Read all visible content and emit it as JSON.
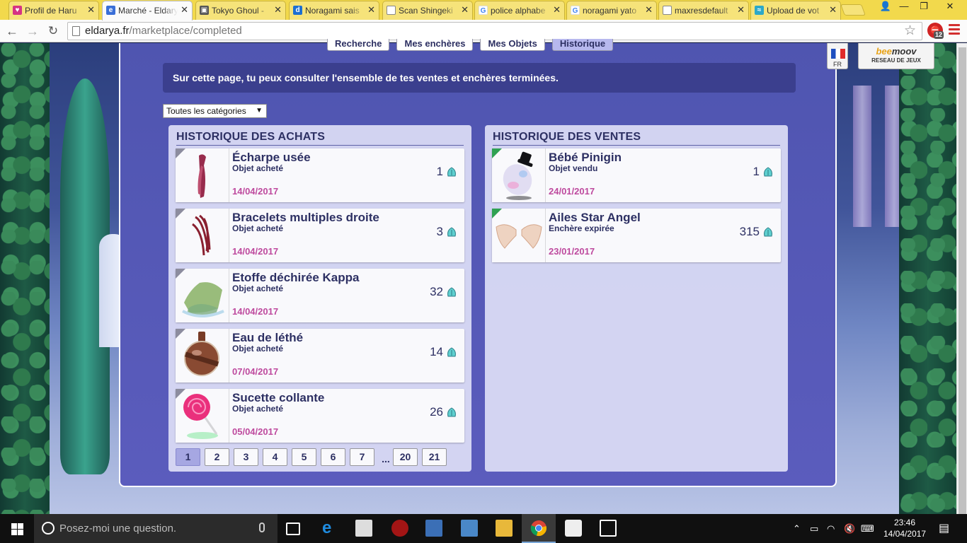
{
  "browser": {
    "tabs": [
      {
        "label": "Profil de Haru",
        "favicon": "heart",
        "color": "#d63384"
      },
      {
        "label": "Marché - Eldarya",
        "favicon": "e",
        "color": "#3a6fd8",
        "active": true
      },
      {
        "label": "Tokyo Ghoul -",
        "favicon": "img",
        "color": "#555555"
      },
      {
        "label": "Noragami sais",
        "favicon": "d",
        "color": "#1d6fd1"
      },
      {
        "label": "Scan Shingeki",
        "favicon": "doc",
        "color": "#888888"
      },
      {
        "label": "police alphabe",
        "favicon": "G",
        "color": "#4285f4"
      },
      {
        "label": "noragami yato",
        "favicon": "G",
        "color": "#4285f4"
      },
      {
        "label": "maxresdefault",
        "favicon": "doc",
        "color": "#888888"
      },
      {
        "label": "Upload de vot",
        "favicon": "upload",
        "color": "#2ca8c8"
      }
    ],
    "url_domain": "eldarya.fr",
    "url_path": "/marketplace/completed",
    "extension_badge": "12"
  },
  "lang": {
    "code": "FR"
  },
  "beemoov": {
    "logo_left": "bee",
    "logo_right": "moov",
    "subtitle": "RESEAU DE JEUX"
  },
  "subtabs": [
    "Recherche",
    "Mes enchères",
    "Mes Objets",
    "Historique"
  ],
  "info_text": "Sur cette page, tu peux consulter l'ensemble de tes ventes et enchères terminées.",
  "category_select": {
    "value": "Toutes les catégories"
  },
  "purchases": {
    "title": "HISTORIQUE DES ACHATS",
    "items": [
      {
        "name": "Écharpe usée",
        "status": "Objet acheté",
        "date": "14/04/2017",
        "price": "1",
        "icon": "scarf-icon"
      },
      {
        "name": "Bracelets multiples droite",
        "status": "Objet acheté",
        "date": "14/04/2017",
        "price": "3",
        "icon": "bracelets-icon"
      },
      {
        "name": "Etoffe déchirée Kappa",
        "status": "Objet acheté",
        "date": "14/04/2017",
        "price": "32",
        "icon": "cloth-icon"
      },
      {
        "name": "Eau de léthé",
        "status": "Objet acheté",
        "date": "07/04/2017",
        "price": "14",
        "icon": "potion-icon"
      },
      {
        "name": "Sucette collante",
        "status": "Objet acheté",
        "date": "05/04/2017",
        "price": "26",
        "icon": "lollipop-icon"
      }
    ],
    "pages": [
      "1",
      "2",
      "3",
      "4",
      "5",
      "6",
      "7",
      "...",
      "20",
      "21"
    ],
    "current_page": "1"
  },
  "sales": {
    "title": "HISTORIQUE DES VENTES",
    "items": [
      {
        "name": "Bébé Pinigin",
        "status": "Objet vendu",
        "date": "24/01/2017",
        "price": "1",
        "icon": "egg-icon"
      },
      {
        "name": "Ailes Star Angel",
        "status": "Enchère expirée",
        "date": "23/01/2017",
        "price": "315",
        "icon": "wings-icon"
      }
    ]
  },
  "taskbar": {
    "search_placeholder": "Posez-moi une question.",
    "time": "23:46",
    "date": "14/04/2017"
  },
  "colors": {
    "panel": "#5b5cbd",
    "title_text": "#2c2f61",
    "date_text": "#c24a9e",
    "maana_icon": "#5fd3d0"
  }
}
